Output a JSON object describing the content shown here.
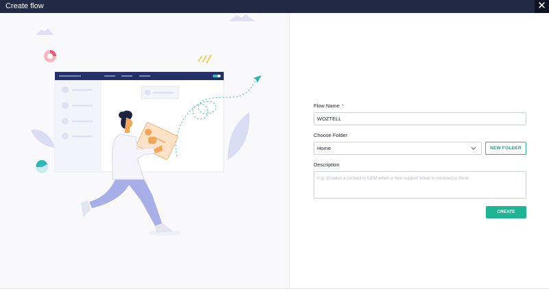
{
  "window": {
    "title": "Create flow",
    "close_icon": "✕"
  },
  "form": {
    "flow_name_label": "Flow Name",
    "required_mark": "*",
    "flow_name_value": "WOZTELL",
    "folder_label": "Choose Folder",
    "folder_value": "Home",
    "new_folder_label": "NEW FOLDER",
    "description_label": "Description",
    "description_placeholder": "E.g. Creates a contact in CRM when a new support ticket is received in Desk",
    "create_label": "CREATE"
  },
  "colors": {
    "header": "#232a45",
    "accent": "#1fb495",
    "figure_pants": "#a8aee8"
  }
}
